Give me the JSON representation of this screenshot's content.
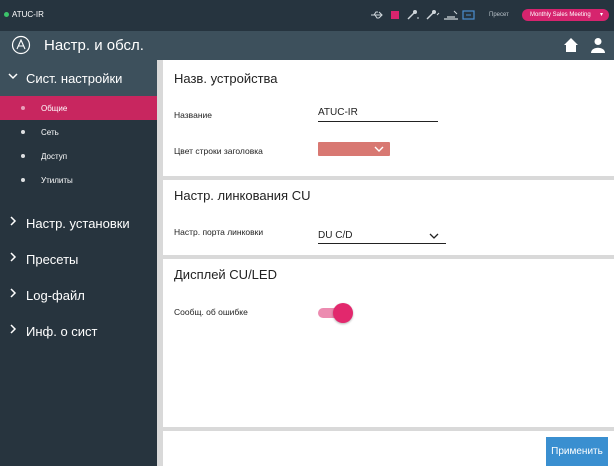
{
  "statusbar": {
    "device_name": "ATUC-IR",
    "status_color": "#3cc36a",
    "icons": [
      "usb-icon",
      "record-icon",
      "mic-low-icon",
      "mic-high-icon",
      "network-icon",
      "display-icon"
    ],
    "preset_label": "Пресет",
    "preset_value": "Monthly Sales Meeting"
  },
  "header": {
    "title": "Настр. и обсл.",
    "icons": [
      "logo-icon",
      "home-icon",
      "user-icon"
    ]
  },
  "sidebar": {
    "open_group": "Сист. настройки",
    "subitems": [
      "Общие",
      "Сеть",
      "Доступ",
      "Утилиты"
    ],
    "active_subitem": "Общие",
    "groups": [
      "Настр. установки",
      "Пресеты",
      "Log-файл",
      "Инф. о сист"
    ]
  },
  "device_section": {
    "title": "Назв. устройства",
    "name_label": "Название",
    "name_value": "ATUC-IR",
    "color_label": "Цвет строки заголовка",
    "color_value": "#d87872"
  },
  "link_section": {
    "title": "Настр. линкования CU",
    "port_label": "Настр. порта линковки",
    "port_value": "DU C/D"
  },
  "display_section": {
    "title": "Дисплей CU/LED",
    "error_label": "Сообщ. об ошибке",
    "error_on": true
  },
  "footer": {
    "apply_label": "Применить"
  },
  "colors": {
    "accent": "#d6246e",
    "sidebar_active": "#c8265f",
    "header_bg": "#3d505c",
    "sidebar_bg": "#27343e",
    "apply_button": "#3a8fd0"
  }
}
